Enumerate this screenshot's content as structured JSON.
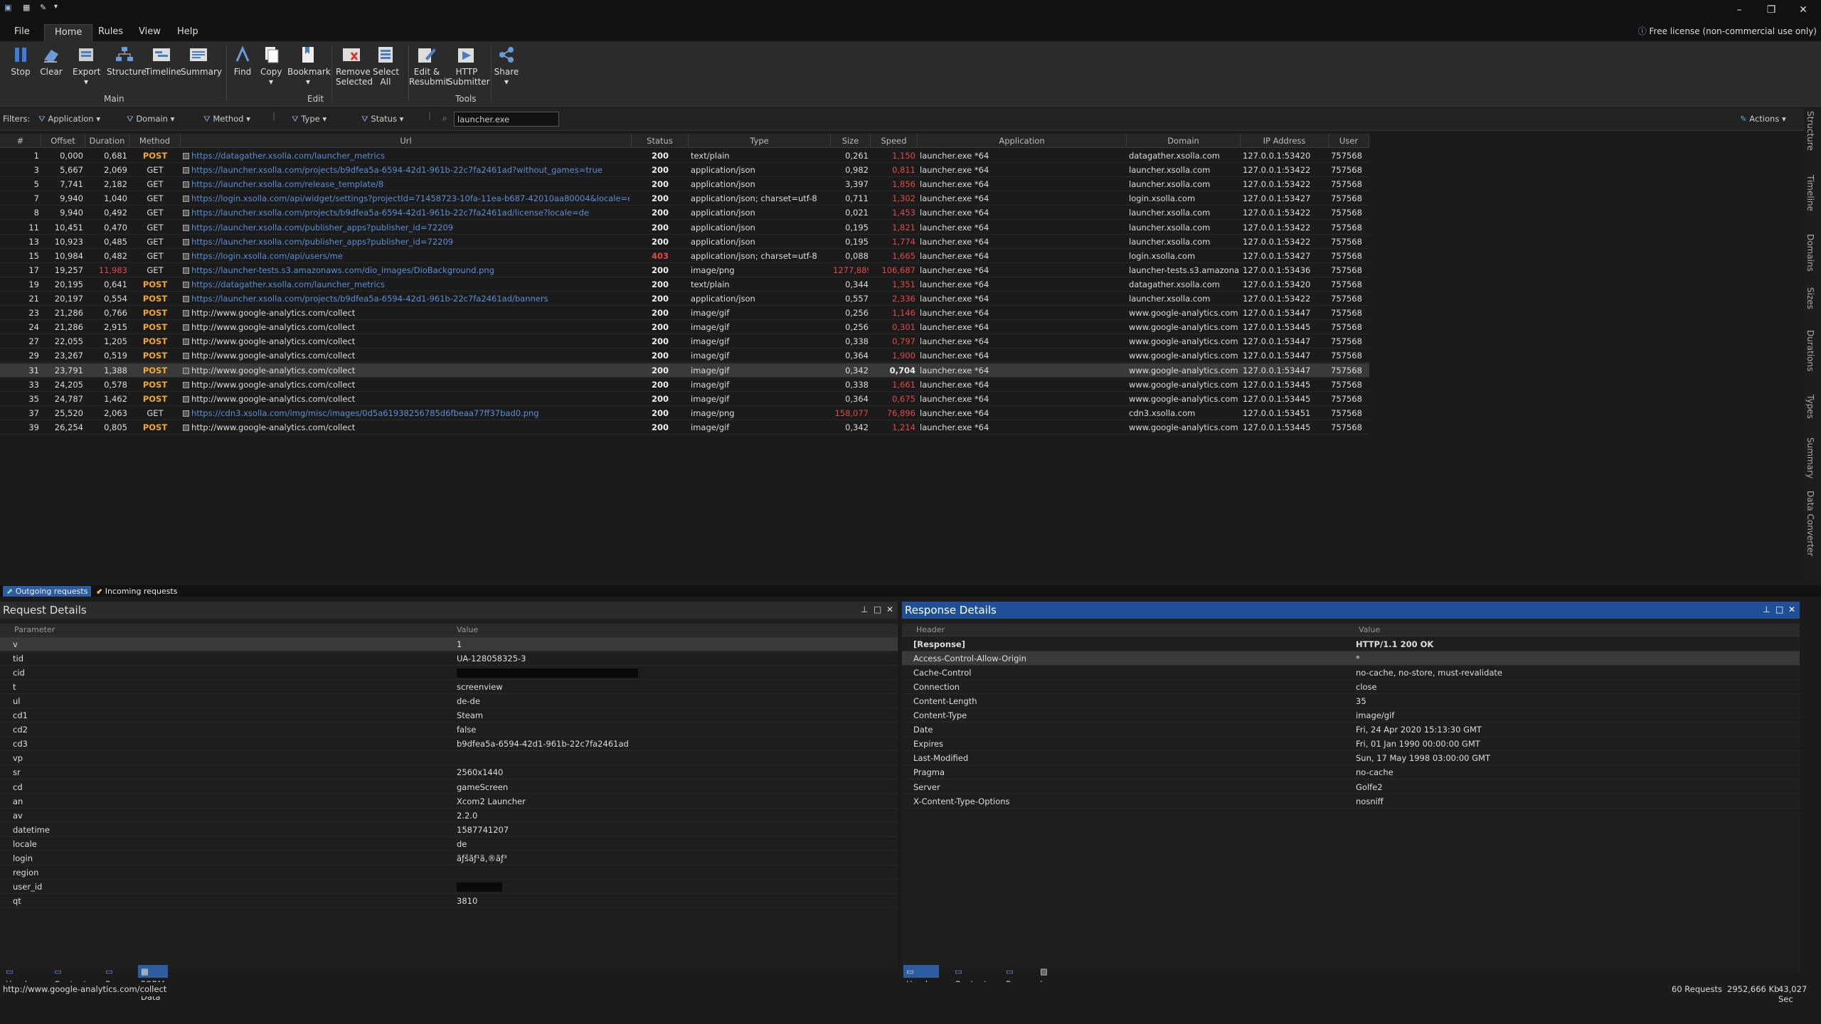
{
  "titlebar": {
    "min": "–",
    "restore": "❐",
    "close": "✕"
  },
  "menu": [
    "File",
    "Home",
    "Rules",
    "View",
    "Help"
  ],
  "license": "Free license (non-commercial use only)",
  "ribbon": {
    "stop": "Stop",
    "clear": "Clear",
    "export": "Export",
    "structure": "Structure",
    "timeline": "Timeline",
    "summary": "Summary",
    "find": "Find",
    "copy": "Copy",
    "bookmark": "Bookmark",
    "remove_selected": "Remove Selected",
    "select_all": "Select All",
    "edit_resubmit": "Edit & Resubmit",
    "http_submitter": "HTTP Submitter",
    "share": "Share",
    "group_main": "Main",
    "group_edit": "Edit",
    "group_tools": "Tools"
  },
  "filters": {
    "label": "Filters:",
    "application": "Application",
    "domain": "Domain",
    "method": "Method",
    "type": "Type",
    "status": "Status",
    "search_value": "launcher.exe",
    "actions": "Actions"
  },
  "columns": [
    "#",
    "Offset",
    "Duration",
    "Method",
    "Url",
    "Status",
    "Type",
    "Size",
    "Speed",
    "Application",
    "Domain",
    "IP Address",
    "User"
  ],
  "rows": [
    {
      "n": "1",
      "off": "0,000",
      "dur": "0,681",
      "m": "POST",
      "url": "https://datagather.xsolla.com/launcher_metrics",
      "st": "200",
      "type": "text/plain",
      "size": "0,261",
      "speed": "1,150",
      "app": "launcher.exe *64",
      "dom": "datagather.xsolla.com",
      "ip": "127.0.0.1:53420",
      "user": "757568"
    },
    {
      "n": "3",
      "off": "5,667",
      "dur": "2,069",
      "m": "GET",
      "url": "https://launcher.xsolla.com/projects/b9dfea5a-6594-42d1-961b-22c7fa2461ad?without_games=true",
      "st": "200",
      "type": "application/json",
      "size": "0,982",
      "speed": "0,811",
      "app": "launcher.exe *64",
      "dom": "launcher.xsolla.com",
      "ip": "127.0.0.1:53422",
      "user": "757568"
    },
    {
      "n": "5",
      "off": "7,741",
      "dur": "2,182",
      "m": "GET",
      "url": "https://launcher.xsolla.com/release_template/8",
      "st": "200",
      "type": "application/json",
      "size": "3,397",
      "speed": "1,856",
      "app": "launcher.exe *64",
      "dom": "launcher.xsolla.com",
      "ip": "127.0.0.1:53422",
      "user": "757568"
    },
    {
      "n": "7",
      "off": "9,940",
      "dur": "1,040",
      "m": "GET",
      "url": "https://login.xsolla.com/api/widget/settings?projectId=71458723-10fa-11ea-b687-42010aa80004&locale=en_XX&...",
      "st": "200",
      "type": "application/json; charset=utf-8",
      "size": "0,711",
      "speed": "1,302",
      "app": "launcher.exe *64",
      "dom": "login.xsolla.com",
      "ip": "127.0.0.1:53427",
      "user": "757568"
    },
    {
      "n": "8",
      "off": "9,940",
      "dur": "0,492",
      "m": "GET",
      "url": "https://launcher.xsolla.com/projects/b9dfea5a-6594-42d1-961b-22c7fa2461ad/license?locale=de",
      "st": "200",
      "type": "application/json",
      "size": "0,021",
      "speed": "1,453",
      "app": "launcher.exe *64",
      "dom": "launcher.xsolla.com",
      "ip": "127.0.0.1:53422",
      "user": "757568"
    },
    {
      "n": "11",
      "off": "10,451",
      "dur": "0,470",
      "m": "GET",
      "url": "https://launcher.xsolla.com/publisher_apps?publisher_id=72209",
      "st": "200",
      "type": "application/json",
      "size": "0,195",
      "speed": "1,821",
      "app": "launcher.exe *64",
      "dom": "launcher.xsolla.com",
      "ip": "127.0.0.1:53422",
      "user": "757568"
    },
    {
      "n": "13",
      "off": "10,923",
      "dur": "0,485",
      "m": "GET",
      "url": "https://launcher.xsolla.com/publisher_apps?publisher_id=72209",
      "st": "200",
      "type": "application/json",
      "size": "0,195",
      "speed": "1,774",
      "app": "launcher.exe *64",
      "dom": "launcher.xsolla.com",
      "ip": "127.0.0.1:53422",
      "user": "757568"
    },
    {
      "n": "15",
      "off": "10,984",
      "dur": "0,482",
      "m": "GET",
      "url": "https://login.xsolla.com/api/users/me",
      "st": "403",
      "type": "application/json; charset=utf-8",
      "size": "0,088",
      "speed": "1,665",
      "app": "launcher.exe *64",
      "dom": "login.xsolla.com",
      "ip": "127.0.0.1:53427",
      "user": "757568"
    },
    {
      "n": "17",
      "off": "19,257",
      "dur": "11,983",
      "m": "GET",
      "url": "https://launcher-tests.s3.amazonaws.com/dio_images/DioBackground.png",
      "st": "200",
      "type": "image/png",
      "size": "1277,889",
      "speed": "106,687",
      "app": "launcher.exe *64",
      "dom": "launcher-tests.s3.amazona...",
      "ip": "127.0.0.1:53436",
      "user": "757568"
    },
    {
      "n": "19",
      "off": "20,195",
      "dur": "0,641",
      "m": "POST",
      "url": "https://datagather.xsolla.com/launcher_metrics",
      "st": "200",
      "type": "text/plain",
      "size": "0,344",
      "speed": "1,351",
      "app": "launcher.exe *64",
      "dom": "datagather.xsolla.com",
      "ip": "127.0.0.1:53420",
      "user": "757568"
    },
    {
      "n": "21",
      "off": "20,197",
      "dur": "0,554",
      "m": "POST",
      "url": "https://launcher.xsolla.com/projects/b9dfea5a-6594-42d1-961b-22c7fa2461ad/banners",
      "st": "200",
      "type": "application/json",
      "size": "0,557",
      "speed": "2,336",
      "app": "launcher.exe *64",
      "dom": "launcher.xsolla.com",
      "ip": "127.0.0.1:53422",
      "user": "757568"
    },
    {
      "n": "23",
      "off": "21,286",
      "dur": "0,766",
      "m": "POST",
      "url": "http://www.google-analytics.com/collect",
      "st": "200",
      "type": "image/gif",
      "size": "0,256",
      "speed": "1,146",
      "app": "launcher.exe *64",
      "dom": "www.google-analytics.com",
      "ip": "127.0.0.1:53447",
      "user": "757568"
    },
    {
      "n": "24",
      "off": "21,286",
      "dur": "2,915",
      "m": "POST",
      "url": "http://www.google-analytics.com/collect",
      "st": "200",
      "type": "image/gif",
      "size": "0,256",
      "speed": "0,301",
      "app": "launcher.exe *64",
      "dom": "www.google-analytics.com",
      "ip": "127.0.0.1:53445",
      "user": "757568"
    },
    {
      "n": "27",
      "off": "22,055",
      "dur": "1,205",
      "m": "POST",
      "url": "http://www.google-analytics.com/collect",
      "st": "200",
      "type": "image/gif",
      "size": "0,338",
      "speed": "0,797",
      "app": "launcher.exe *64",
      "dom": "www.google-analytics.com",
      "ip": "127.0.0.1:53447",
      "user": "757568"
    },
    {
      "n": "29",
      "off": "23,267",
      "dur": "0,519",
      "m": "POST",
      "url": "http://www.google-analytics.com/collect",
      "st": "200",
      "type": "image/gif",
      "size": "0,364",
      "speed": "1,900",
      "app": "launcher.exe *64",
      "dom": "www.google-analytics.com",
      "ip": "127.0.0.1:53447",
      "user": "757568"
    },
    {
      "n": "31",
      "off": "23,791",
      "dur": "1,388",
      "m": "POST",
      "url": "http://www.google-analytics.com/collect",
      "st": "200",
      "type": "image/gif",
      "size": "0,342",
      "speed": "0,704",
      "app": "launcher.exe *64",
      "dom": "www.google-analytics.com",
      "ip": "127.0.0.1:53447",
      "user": "757568",
      "sel": true
    },
    {
      "n": "33",
      "off": "24,205",
      "dur": "0,578",
      "m": "POST",
      "url": "http://www.google-analytics.com/collect",
      "st": "200",
      "type": "image/gif",
      "size": "0,338",
      "speed": "1,661",
      "app": "launcher.exe *64",
      "dom": "www.google-analytics.com",
      "ip": "127.0.0.1:53445",
      "user": "757568"
    },
    {
      "n": "35",
      "off": "24,787",
      "dur": "1,462",
      "m": "POST",
      "url": "http://www.google-analytics.com/collect",
      "st": "200",
      "type": "image/gif",
      "size": "0,364",
      "speed": "0,675",
      "app": "launcher.exe *64",
      "dom": "www.google-analytics.com",
      "ip": "127.0.0.1:53445",
      "user": "757568"
    },
    {
      "n": "37",
      "off": "25,520",
      "dur": "2,063",
      "m": "GET",
      "url": "https://cdn3.xsolla.com/img/misc/images/0d5a61938256785d6fbeaa77ff37bad0.png",
      "st": "200",
      "type": "image/png",
      "size": "158,077",
      "speed": "76,896",
      "app": "launcher.exe *64",
      "dom": "cdn3.xsolla.com",
      "ip": "127.0.0.1:53451",
      "user": "757568"
    },
    {
      "n": "39",
      "off": "26,254",
      "dur": "0,805",
      "m": "POST",
      "url": "http://www.google-analytics.com/collect",
      "st": "200",
      "type": "image/gif",
      "size": "0,342",
      "speed": "1,214",
      "app": "launcher.exe *64",
      "dom": "www.google-analytics.com",
      "ip": "127.0.0.1:53445",
      "user": "757568"
    }
  ],
  "side_tabs": [
    "Structure",
    "Timeline",
    "Domains",
    "Sizes",
    "Durations",
    "Types",
    "Summary",
    "Data Converter"
  ],
  "direction_tabs": {
    "outgoing": "Outgoing requests",
    "incoming": "Incoming requests"
  },
  "request": {
    "title": "Request Details",
    "col1": "Parameter",
    "col2": "Value",
    "rows": [
      {
        "k": "v",
        "v": "1"
      },
      {
        "k": "tid",
        "v": "UA-128058325-3"
      },
      {
        "k": "cid",
        "v": ""
      },
      {
        "k": "t",
        "v": "screenview"
      },
      {
        "k": "ul",
        "v": "de-de"
      },
      {
        "k": "cd1",
        "v": "Steam"
      },
      {
        "k": "cd2",
        "v": "false"
      },
      {
        "k": "cd3",
        "v": "b9dfea5a-6594-42d1-961b-22c7fa2461ad"
      },
      {
        "k": "vp",
        "v": ""
      },
      {
        "k": "sr",
        "v": "2560x1440"
      },
      {
        "k": "cd",
        "v": "gameScreen"
      },
      {
        "k": "an",
        "v": "Xcom2 Launcher"
      },
      {
        "k": "av",
        "v": "2.2.0"
      },
      {
        "k": "datetime",
        "v": "1587741207"
      },
      {
        "k": "locale",
        "v": "de"
      },
      {
        "k": "login",
        "v": "ãƒšãƒ¹ã‚®ãƒ³"
      },
      {
        "k": "region",
        "v": ""
      },
      {
        "k": "user_id",
        "v": ""
      },
      {
        "k": "qt",
        "v": "3810"
      }
    ],
    "tabs": [
      "Header",
      "Content",
      "Raw",
      "FORM Data"
    ]
  },
  "response": {
    "title": "Response Details",
    "col1": "Header",
    "col2": "Value",
    "rows": [
      {
        "k": "[Response]",
        "v": "HTTP/1.1 200 OK"
      },
      {
        "k": "Access-Control-Allow-Origin",
        "v": "*"
      },
      {
        "k": "Cache-Control",
        "v": "no-cache, no-store, must-revalidate"
      },
      {
        "k": "Connection",
        "v": "close"
      },
      {
        "k": "Content-Length",
        "v": "35"
      },
      {
        "k": "Content-Type",
        "v": "image/gif"
      },
      {
        "k": "Date",
        "v": "Fri, 24 Apr 2020 15:13:30 GMT"
      },
      {
        "k": "Expires",
        "v": "Fri, 01 Jan 1990 00:00:00 GMT"
      },
      {
        "k": "Last-Modified",
        "v": "Sun, 17 May 1998 03:00:00 GMT"
      },
      {
        "k": "Pragma",
        "v": "no-cache"
      },
      {
        "k": "Server",
        "v": "Golfe2"
      },
      {
        "k": "X-Content-Type-Options",
        "v": "nosniff"
      }
    ],
    "tabs": [
      "Header",
      "Content",
      "Raw",
      "Image"
    ]
  },
  "status": {
    "url": "http://www.google-analytics.com/collect",
    "requests": "60 Requests",
    "size": "2952,666 Kb",
    "time": "43,027 Sec"
  },
  "colors": {
    "accent": "#2d5da0",
    "post": "#f0a830",
    "link": "#5b8ed6",
    "slow": "#e54848"
  }
}
